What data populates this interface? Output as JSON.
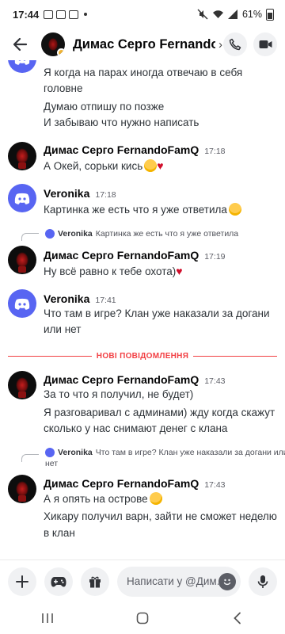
{
  "status_bar": {
    "time": "17:44",
    "battery": "61%"
  },
  "header": {
    "title": "Димас Серго Fernando...",
    "chevron": "›"
  },
  "messages": [
    {
      "id": "m0",
      "author": "",
      "time": "",
      "lines": [
        "Я когда на парах иногда отвечаю в себя",
        "головне",
        "Думаю отпишу по позже",
        "И забываю что нужно написать"
      ]
    },
    {
      "id": "m1",
      "author": "Димас Серго FernandoFamQ",
      "time": "17:18",
      "lines": [
        "А Окей, сорьки кись"
      ]
    },
    {
      "id": "m2",
      "author": "Veronika",
      "time": "17:18",
      "lines": [
        "Картинка же есть что я уже ответила"
      ]
    },
    {
      "id": "m3",
      "reply": {
        "author": "Veronika",
        "text": "Картинка же есть что я уже ответила"
      },
      "author": "Димас Серго FernandoFamQ",
      "time": "17:19",
      "lines": [
        "Ну всё равно к тебе охота)"
      ]
    },
    {
      "id": "m4",
      "author": "Veronika",
      "time": "17:41",
      "lines": [
        "Что там в игре? Клан уже наказали за догани",
        "или нет"
      ]
    },
    {
      "id": "m5",
      "author": "Димас Серго FernandoFamQ",
      "time": "17:43",
      "lines": [
        "За то что я получил, не будет)",
        "Я разговаривал с админами) жду когда скажут",
        "сколько у нас снимают денег с клана"
      ]
    },
    {
      "id": "m6",
      "reply": {
        "author": "Veronika",
        "text": "Что там в игре? Клан уже наказали за догани или",
        "text2": "нет"
      },
      "author": "Димас Серго FernandoFamQ",
      "time": "17:43",
      "lines": [
        "А я опять на острове",
        "Хикару получил варн, зайти не сможет неделю",
        "в клан"
      ]
    }
  ],
  "new_messages_divider": "НОВІ ПОВІДОМЛЕННЯ",
  "composer": {
    "placeholder": "Написати у @Дим..."
  },
  "colors": {
    "discord_blurple": "#5865f2",
    "new_divider": "#f23f43",
    "idle_status": "#f0b232"
  },
  "icons": {
    "back": "arrow-left-icon",
    "call": "phone-icon",
    "video": "video-camera-icon",
    "add": "plus-icon",
    "games": "gamepad-icon",
    "gift": "gift-icon",
    "emoji": "smile-icon",
    "voice": "microphone-icon"
  }
}
